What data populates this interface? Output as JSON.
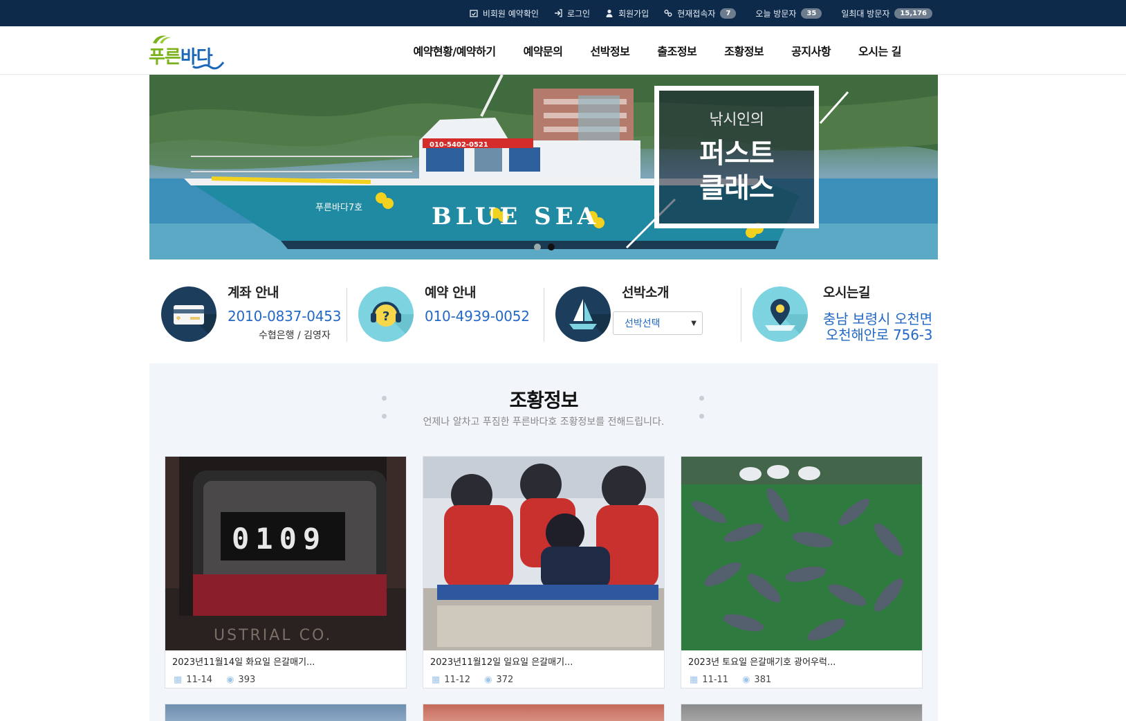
{
  "topbar": {
    "items": [
      {
        "icon": "calendar-check-icon",
        "label": "비회원 예약확인"
      },
      {
        "icon": "sign-in-icon",
        "label": "로그인"
      },
      {
        "icon": "user-icon",
        "label": "회원가입"
      },
      {
        "icon": "link-icon",
        "label": "현재접속자",
        "badge": "7"
      },
      {
        "label": "오늘 방문자",
        "badge": "35"
      },
      {
        "label": "일최대 방문자",
        "badge": "15,176"
      }
    ]
  },
  "header": {
    "logo_green": "푸른",
    "logo_blue": "바다"
  },
  "nav": [
    "예약현황/예약하기",
    "예약문의",
    "선박정보",
    "출조정보",
    "조황정보",
    "공지사항",
    "오시는 길"
  ],
  "hero": {
    "subtitle": "낚시인의",
    "title_line1": "퍼스트",
    "title_line2": "클래스",
    "boat_text": "BLUE SEA",
    "boat_name": "푸른바다7호",
    "boat_phone": "010-5402-0521",
    "slides": 2,
    "active_slide": 2
  },
  "info": {
    "account": {
      "title": "계좌 안내",
      "number": "2010-0837-0453",
      "detail": "수협은행 / 김영자"
    },
    "reservation": {
      "title": "예약 안내",
      "phone": "010-4939-0052"
    },
    "vessel": {
      "title": "선박소개",
      "select_value": "선박선택"
    },
    "directions": {
      "title": "오시는길",
      "line1": "충남 보령시 오천면",
      "line2": "오천해안로 756-3"
    }
  },
  "fishing": {
    "title": "조황정보",
    "subtitle": "언제나 알차고 푸짐한 푸른바다호 조황정보를 전해드립니다.",
    "posts": [
      {
        "title": "2023년11월14일 화요일 은갈매기...",
        "date": "11-14",
        "views": "393",
        "image": "counter-0109",
        "counter": "0109"
      },
      {
        "title": "2023년11월12일 일요일 은갈매기...",
        "date": "11-12",
        "views": "372",
        "image": "anglers-group"
      },
      {
        "title": "2023년 토요일 은갈매기호 광어우럭...",
        "date": "11-11",
        "views": "381",
        "image": "fish-catch"
      }
    ]
  },
  "colors": {
    "topbar": "#0d2a4b",
    "accent_blue": "#2368c4",
    "logo_green": "#7cb31c",
    "section_bg": "#f2f6fa"
  }
}
